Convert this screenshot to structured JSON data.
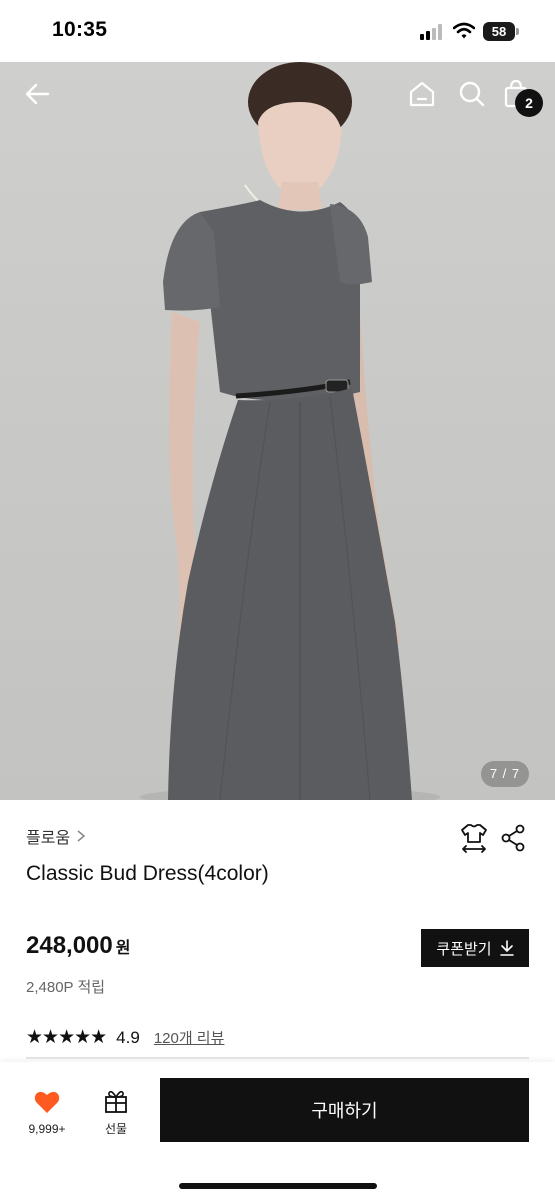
{
  "status_bar": {
    "time": "10:35",
    "battery": "58"
  },
  "header": {
    "back_icon": "back-arrow-icon",
    "home_icon": "home-icon",
    "search_icon": "search-icon",
    "bag_icon": "shopping-bag-icon",
    "bag_count": "2"
  },
  "gallery": {
    "counter": "7 / 7"
  },
  "product": {
    "brand": "플로움",
    "title": "Classic Bud Dress(4color)",
    "price": "248,000",
    "currency": "원",
    "points": "2,480P 적립",
    "coupon_label": "쿠폰받기",
    "rating": {
      "stars": "★★★★★",
      "value": "4.9",
      "reviews_link": "120개 리뷰"
    }
  },
  "bottom_bar": {
    "like_count": "9,999+",
    "gift_label": "선물",
    "buy_label": "구매하기",
    "accent_color": "#ff5a1f"
  }
}
